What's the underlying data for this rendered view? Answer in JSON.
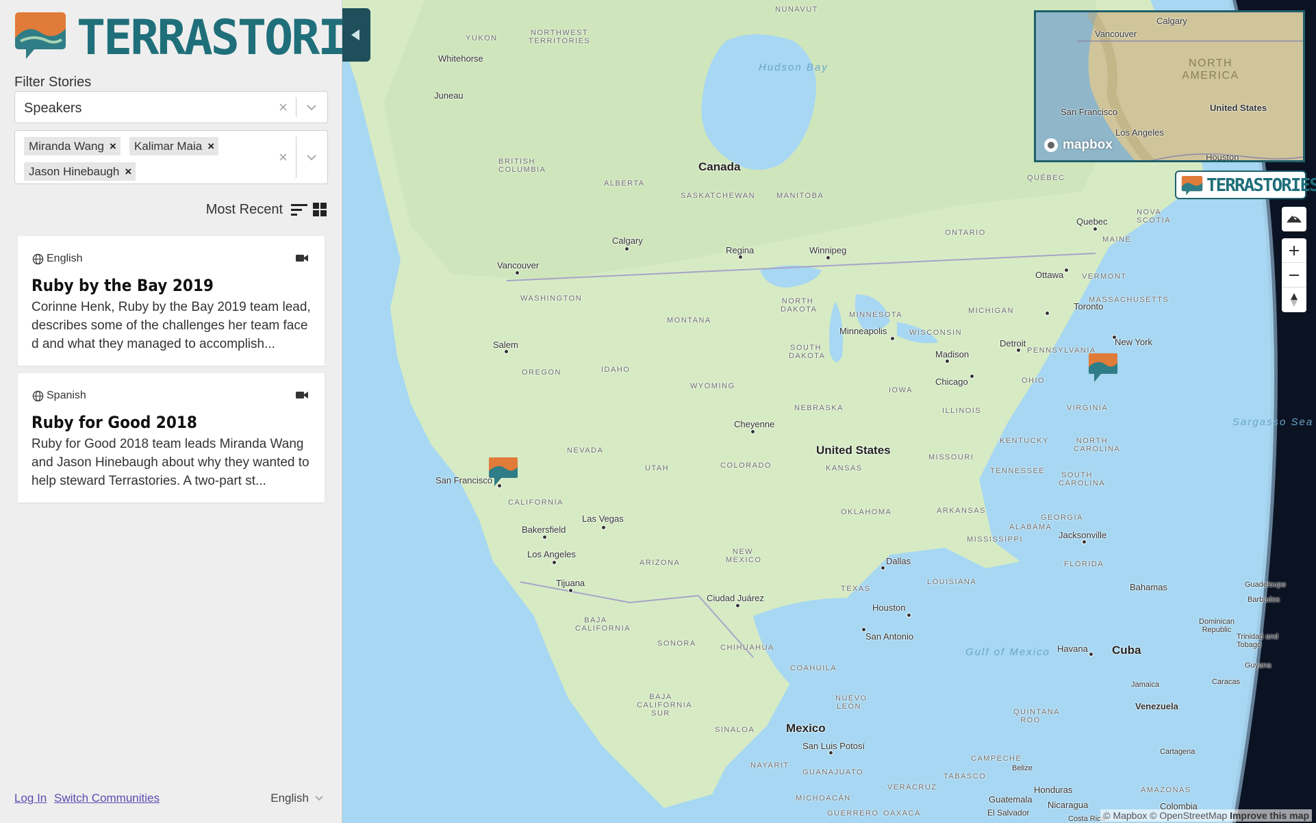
{
  "app": {
    "name": "TERRASTORIES"
  },
  "sidebar": {
    "filter_label": "Filter Stories",
    "speakers_select": {
      "value": "Speakers"
    },
    "selected_speakers": [
      "Miranda Wang",
      "Kalimar Maia",
      "Jason Hinebaugh"
    ],
    "sort_label": "Most Recent",
    "stories": [
      {
        "language": "English",
        "title": "Ruby by the Bay 2019",
        "description": "Corinne Henk, Ruby by the Bay 2019 team lead, describes some of the challenges her team faced and what they managed to accomplish..."
      },
      {
        "language": "Spanish",
        "title": "Ruby for Good 2018",
        "description": "Ruby for Good 2018 team leads Miranda Wang and Jason Hinebaugh about why they wanted to help steward Terrastories. A two-part st..."
      }
    ],
    "footer": {
      "login": "Log In",
      "switch": "Switch Communities",
      "language": "English"
    }
  },
  "map": {
    "countries": {
      "canada": "Canada",
      "usa": "United States",
      "mexico": "Mexico",
      "cuba": "Cuba",
      "venezuela": "Venezuela"
    },
    "water": {
      "hudson": "Hudson Bay",
      "gulf": "Gulf of Mexico",
      "sargasso": "Sargasso Sea"
    },
    "cities": {
      "vancouver": "Vancouver",
      "calgary": "Calgary",
      "regina": "Regina",
      "winnipeg": "Winnipeg",
      "ottawa": "Ottawa",
      "quebec": "Quebec",
      "toronto": "Toronto",
      "newyork": "New York",
      "detroit": "Detroit",
      "chicago": "Chicago",
      "madison": "Madison",
      "minneapolis": "Minneapolis",
      "salem": "Salem",
      "sanfrancisco": "San Francisco",
      "cheyenne": "Cheyenne",
      "lasvegas": "Las Vegas",
      "bakersfield": "Bakersfield",
      "losangeles": "Los Angeles",
      "tijuana": "Tijuana",
      "ciudadjuarez": "Ciudad Juárez",
      "dallas": "Dallas",
      "houston": "Houston",
      "sanantonio": "San Antonio",
      "jacksonville": "Jacksonville",
      "havana": "Havana",
      "sanluis": "San Luis Potosí",
      "juneau": "Juneau",
      "whitehorse": "Whitehorse",
      "nassau": "Bahamas",
      "guadeloupe": "Guadeloupe",
      "barbados": "Barbados",
      "dominican": "Dominican Republic",
      "trinidad": "Trinidad and Tobago",
      "guyana": "Guyana",
      "caracas": "Caracas",
      "jamaica": "Jamaica",
      "cartagena": "Cartagena",
      "belize": "Belize",
      "honduras": "Honduras",
      "guatemala": "Guatemala",
      "nicaragua": "Nicaragua",
      "elsalvador": "El Salvador",
      "colombia": "Colombia",
      "costarica": "Costa Rica"
    },
    "regions": {
      "nunavut": "NUNAVUT",
      "yukon": "YUKON",
      "nwt": "NORTHWEST TERRITORIES",
      "bc": "BRITISH COLUMBIA",
      "alberta": "ALBERTA",
      "saskatchewan": "SASKATCHEWAN",
      "manitoba": "MANITOBA",
      "ontario": "ONTARIO",
      "quebec": "QUÉBEC",
      "novascotia": "NOVA SCOTIA",
      "maine": "MAINE",
      "vermont": "VERMONT",
      "massachusetts": "MASSACHUSETTS",
      "washington": "WASHINGTON",
      "oregon": "OREGON",
      "idaho": "IDAHO",
      "montana": "MONTANA",
      "wyoming": "WYOMING",
      "nevada": "NEVADA",
      "utah": "UTAH",
      "colorado": "COLORADO",
      "california": "CALIFORNIA",
      "arizona": "ARIZONA",
      "newmexico": "NEW MEXICO",
      "northdakota": "NORTH DAKOTA",
      "southdakota": "SOUTH DAKOTA",
      "nebraska": "NEBRASKA",
      "kansas": "KANSAS",
      "oklahoma": "OKLAHOMA",
      "texas": "TEXAS",
      "minnesota": "MINNESOTA",
      "iowa": "IOWA",
      "missouri": "MISSOURI",
      "arkansas": "ARKANSAS",
      "louisiana": "LOUISIANA",
      "wisconsin": "WISCONSIN",
      "illinois": "ILLINOIS",
      "michigan": "MICHIGAN",
      "ohio": "OHIO",
      "kentucky": "KENTUCKY",
      "tennessee": "TENNESSEE",
      "mississippi": "MISSISSIPPI",
      "alabama": "ALABAMA",
      "georgia": "GEORGIA",
      "florida": "FLORIDA",
      "pennsylvania": "PENNSYLVANIA",
      "virginia": "VIRGINIA",
      "northcarolina": "NORTH CAROLINA",
      "southcarolina": "SOUTH CAROLINA",
      "bajacalifornia": "BAJA CALIFORNIA",
      "bajacaliforniasur": "BAJA CALIFORNIA SUR",
      "sonora": "SONORA",
      "chihuahua": "CHIHUAHUA",
      "coahuila": "COAHUILA",
      "nuevoleon": "NUEVO LEÓN",
      "sinaloa": "SINALOA",
      "nayarit": "NAYARIT",
      "guanajuato": "GUANAJUATO",
      "michoacan": "MICHOACÁN",
      "guerrero": "GUERRERO",
      "oaxaca": "OAXACA",
      "veracruz": "VERACRUZ",
      "tabasco": "TABASCO",
      "campeche": "CAMPECHE",
      "quintanaroo": "QUINTANA ROO",
      "amazonas": "AMAZONAS"
    },
    "minimap": {
      "brand": "mapbox",
      "labels": {
        "calgary": "Calgary",
        "vancouver": "Vancouver",
        "na": "NORTH AMERICA",
        "us": "United States",
        "sf": "San Francisco",
        "la": "Los Angeles",
        "houston": "Houston"
      }
    },
    "brand_badge": "TERRASTORIES",
    "attribution": {
      "mapbox": "© Mapbox",
      "osm": "© OpenStreetMap",
      "improve": "Improve this map"
    }
  }
}
